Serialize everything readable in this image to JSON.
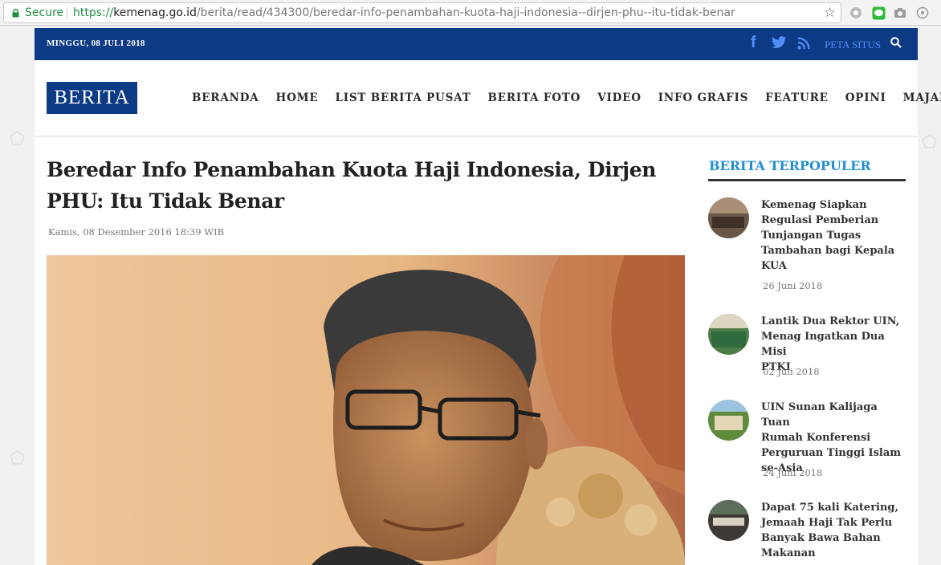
{
  "browser": {
    "secure_label": "Secure",
    "url_proto": "https://",
    "url_host": "kemenag.go.id",
    "url_path": "/berita/read/434300/beredar-info-penambahan-kuota-haji-indonesia--dirjen-phu--itu-tidak-benar",
    "icons": [
      "lock-icon",
      "bookmark-star-icon",
      "extension-icon",
      "line-icon",
      "camera-icon",
      "menu-icon"
    ]
  },
  "topbar": {
    "date": "MINGGU, 08 JULI 2018",
    "sitemap_label": "PETA SITUS",
    "icons": [
      "facebook-icon",
      "twitter-icon",
      "rss-icon",
      "search-icon"
    ]
  },
  "header": {
    "logo": "BERITA",
    "nav": [
      "BERANDA",
      "HOME",
      "LIST BERITA PUSAT",
      "BERITA FOTO",
      "VIDEO",
      "INFO GRAFIS",
      "FEATURE",
      "OPINI",
      "MAJALAH"
    ]
  },
  "article": {
    "title_line1": "Beredar Info Penambahan Kuota Haji Indonesia, Dirjen",
    "title_line2": "PHU: Itu Tidak Benar",
    "meta": "Kamis, 08 Desember 2016 18:39 WIB"
  },
  "sidebar": {
    "title": "BERITA TERPOPULER",
    "items": [
      {
        "lines": [
          "Kemenag Siapkan",
          "Regulasi Pemberian",
          "Tunjangan Tugas",
          "Tambahan bagi Kepala",
          "KUA"
        ],
        "date": "26 Juni 2018"
      },
      {
        "lines": [
          "Lantik Dua Rektor UIN,",
          "Menag Ingatkan Dua Misi",
          "PTKI"
        ],
        "date": "02 Juli 2018"
      },
      {
        "lines": [
          "UIN Sunan Kalijaga Tuan",
          "Rumah Konferensi",
          "Perguruan Tinggi Islam",
          "se-Asia"
        ],
        "date": "24 Juni 2018"
      },
      {
        "lines": [
          "Dapat 75 kali Katering,",
          "Jemaah Haji Tak Perlu",
          "Banyak Bawa Bahan",
          "Makanan"
        ],
        "date": ""
      }
    ]
  },
  "colors": {
    "brand_blue": "#0c3a85",
    "link_blue": "#1f8fd6",
    "secure_green": "#1e8e3e"
  }
}
